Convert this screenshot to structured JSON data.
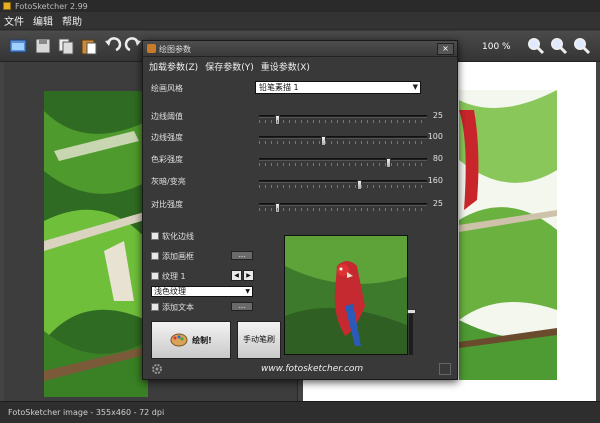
{
  "app": {
    "title": "FotoSketcher 2.99"
  },
  "menu": {
    "file": "文件",
    "edit": "编辑",
    "help": "帮助"
  },
  "toolbar": {
    "zoom": "100 %"
  },
  "status": {
    "text": "FotoSketcher image - 355x460 - 72 dpi"
  },
  "dialog": {
    "title": "绘图参数",
    "close": "×",
    "menu": {
      "load": "加载参数(Z)",
      "save": "保存参数(Y)",
      "reset": "重设参数(X)"
    },
    "style_label": "绘画风格",
    "style_value": "铅笔素描 1",
    "sliders": [
      {
        "label": "边线阈值",
        "value": "25",
        "fraction": 0.1
      },
      {
        "label": "边线强度",
        "value": "100",
        "fraction": 0.38
      },
      {
        "label": "色彩强度",
        "value": "80",
        "fraction": 0.78
      },
      {
        "label": "灰暗/变亮",
        "value": "160",
        "fraction": 0.6
      },
      {
        "label": "对比强度",
        "value": "25",
        "fraction": 0.1
      }
    ],
    "options": {
      "soften": "软化边线",
      "frame": "添加画框",
      "texture": "纹理 1",
      "texture_select": "浅色纹理",
      "text": "添加文本",
      "dots": "..."
    },
    "buttons": {
      "draw": "绘制!",
      "manual": "手动笔刷"
    },
    "url": "www.fotosketcher.com"
  }
}
